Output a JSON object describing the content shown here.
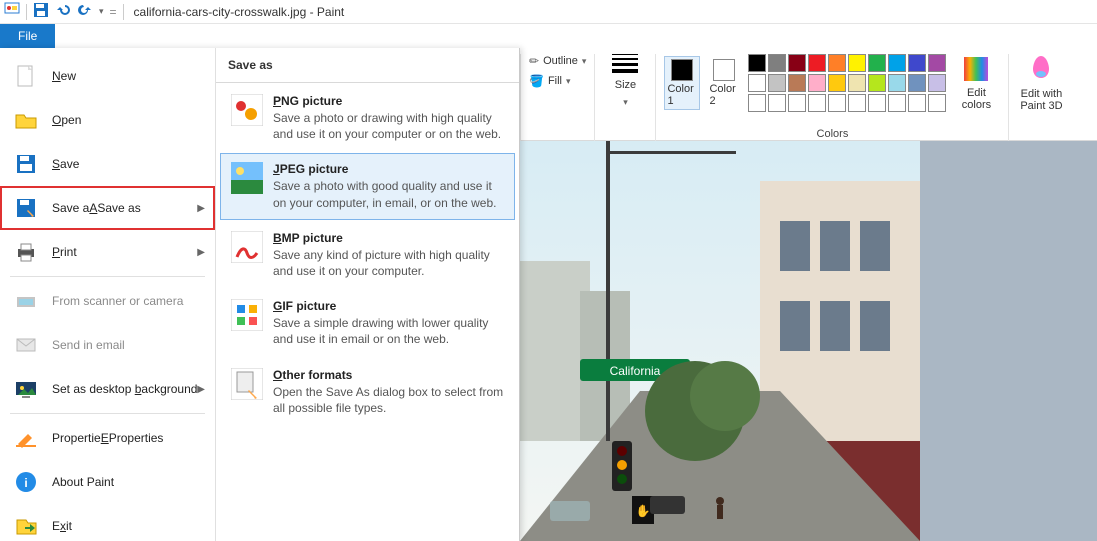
{
  "title": "california-cars-city-crosswalk.jpg - Paint",
  "file_tab": "File",
  "backstage": {
    "items": [
      {
        "key": "new",
        "label": "New",
        "u": "N",
        "dim": false
      },
      {
        "key": "open",
        "label": "Open",
        "u": "O",
        "dim": false
      },
      {
        "key": "save",
        "label": "Save",
        "u": "S",
        "dim": false
      },
      {
        "key": "saveas",
        "label": "Save as",
        "u": "A",
        "dim": false,
        "arrow": true,
        "highlight": true
      },
      {
        "key": "print",
        "label": "Print",
        "u": "P",
        "dim": false,
        "arrow": true
      },
      {
        "key": "scanner",
        "label": "From scanner or camera",
        "dim": true
      },
      {
        "key": "email",
        "label": "Send in email",
        "dim": true
      },
      {
        "key": "wallpaper",
        "label": "Set as desktop background",
        "u": "b",
        "dim": false,
        "arrow": true
      },
      {
        "key": "props",
        "label": "Properties",
        "u": "E",
        "dim": false
      },
      {
        "key": "about",
        "label": "About Paint",
        "dim": false
      },
      {
        "key": "exit",
        "label": "Exit",
        "u": "x",
        "dim": false
      }
    ],
    "panel_header": "Save as",
    "formats": [
      {
        "key": "png",
        "title": "PNG picture",
        "desc": "Save a photo or drawing with high quality and use it on your computer or on the web."
      },
      {
        "key": "jpeg",
        "title": "JPEG picture",
        "desc": "Save a photo with good quality and use it on your computer, in email, or on the web.",
        "selected": true
      },
      {
        "key": "bmp",
        "title": "BMP picture",
        "desc": "Save any kind of picture with high quality and use it on your computer."
      },
      {
        "key": "gif",
        "title": "GIF picture",
        "desc": "Save a simple drawing with lower quality and use it in email or on the web."
      },
      {
        "key": "other",
        "title": "Other formats",
        "desc": "Open the Save As dialog box to select from all possible file types."
      }
    ]
  },
  "ribbon": {
    "outline": "Outline",
    "fill": "Fill",
    "size": "Size",
    "color1": "Color 1",
    "color2": "Color 2",
    "colors_label": "Colors",
    "edit_colors": "Edit colors",
    "paint3d": "Edit with Paint 3D",
    "c1": "#000000",
    "c2": "#ffffff",
    "palette": [
      "#000000",
      "#7f7f7f",
      "#880015",
      "#ed1c24",
      "#ff7f27",
      "#fff200",
      "#22b14c",
      "#00a2e8",
      "#3f48cc",
      "#a349a4",
      "#ffffff",
      "#c3c3c3",
      "#b97a57",
      "#ffaec9",
      "#ffc90e",
      "#efe4b0",
      "#b5e61d",
      "#99d9ea",
      "#7092be",
      "#c8bfe7",
      "#ffffff",
      "#ffffff",
      "#ffffff",
      "#ffffff",
      "#ffffff",
      "#ffffff",
      "#ffffff",
      "#ffffff",
      "#ffffff",
      "#ffffff"
    ]
  },
  "photo": {
    "sign": "California"
  }
}
